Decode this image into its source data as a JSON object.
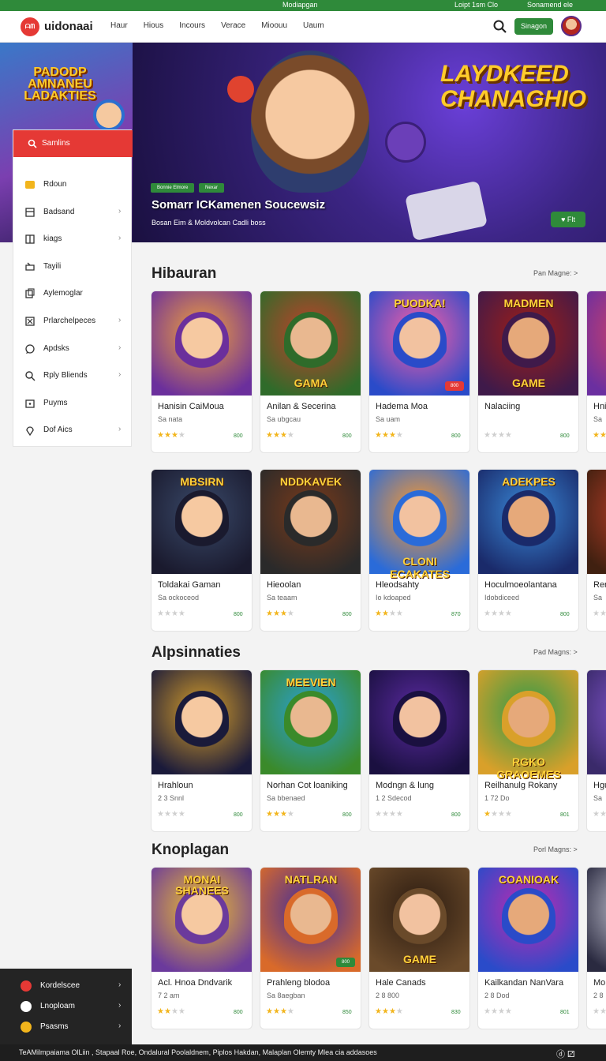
{
  "topstrip": {
    "center": "Modiapgan",
    "right1": "Loipt 1sm Clo",
    "right2": "Sonamend ele"
  },
  "header": {
    "logo_mark": "ᗩᗰ",
    "logo": "uidonaai",
    "nav": [
      "Haur",
      "Hious",
      "Incours",
      "Verace",
      "Mioouu",
      "Uaum"
    ],
    "button": "Sinagon"
  },
  "hero": {
    "left_art_text": "PADODP AMNANEU LADAKTIES",
    "title": "LAYDKEED CHANAGHIO",
    "tag1": "Bonnie Elmore",
    "tag2": "Nexar",
    "subtitle": "Somarr ICKamenen Soucewsiz",
    "caption": "Bosan Eim & Moldvolcan Cadli boss",
    "play_label": "Flt"
  },
  "sidebar": {
    "search_label": "Samlins",
    "items": [
      {
        "label": "Rdoun",
        "icon": "crown-icon",
        "chevron": false
      },
      {
        "label": "Badsand",
        "icon": "box-icon",
        "chevron": true
      },
      {
        "label": "kiags",
        "icon": "bookmark-icon",
        "chevron": true
      },
      {
        "label": "Tayili",
        "icon": "gamepad-icon",
        "chevron": false
      },
      {
        "label": "Aylemoglar",
        "icon": "cards-icon",
        "chevron": false
      },
      {
        "label": "Prlarchelpeces",
        "icon": "grid-icon",
        "chevron": true
      },
      {
        "label": "Apdsks",
        "icon": "chat-icon",
        "chevron": true
      },
      {
        "label": "Rply Bliends",
        "icon": "search-icon",
        "chevron": true
      },
      {
        "label": "Puyms",
        "icon": "dice-icon",
        "chevron": false
      },
      {
        "label": "Dof Aics",
        "icon": "pin-icon",
        "chevron": true
      }
    ]
  },
  "bottom_panel": {
    "items": [
      {
        "label": "Kordelscee",
        "icon": "shield-icon",
        "color": "#e53935"
      },
      {
        "label": "Lnoploam",
        "icon": "envelope-icon",
        "color": "#ffffff"
      },
      {
        "label": "Psasms",
        "icon": "coin-icon",
        "color": "#f2b51c"
      }
    ]
  },
  "sections": [
    {
      "title": "Hibauran",
      "see_more": "Pan Magne: >",
      "cards": [
        {
          "title": "Hanisin CaiMoua",
          "sub": "Sa nata",
          "stars": 3,
          "meta": "800",
          "caption": "",
          "caption2": "",
          "badge": ""
        },
        {
          "title": "Anilan & Secerina",
          "sub": "Sa ubgcau",
          "stars": 3,
          "meta": "800",
          "caption": "",
          "caption2": "GAMA",
          "badge": ""
        },
        {
          "title": "Hadema Moa",
          "sub": "Sa uam",
          "stars": 3,
          "meta": "800",
          "caption": "PUODKA!",
          "caption2": "",
          "badge": "800"
        },
        {
          "title": "Nalaciing",
          "sub": "",
          "stars": 0,
          "meta": "800",
          "caption": "MADMEN",
          "caption2": "GAME",
          "badge": ""
        },
        {
          "title": "Hni",
          "sub": "Sa",
          "stars": 3,
          "meta": "",
          "caption": "",
          "caption2": "",
          "badge": ""
        }
      ]
    },
    {
      "title": "",
      "see_more": "",
      "cards": [
        {
          "title": "Toldakai Gaman",
          "sub": "Sa ockoceod",
          "stars": 0,
          "meta": "800",
          "caption": "MBSIRN",
          "caption2": "",
          "badge": ""
        },
        {
          "title": "Hieoolan",
          "sub": "Sa teaam",
          "stars": 3,
          "meta": "800",
          "caption": "NDDKAVEK",
          "caption2": "",
          "badge": ""
        },
        {
          "title": "Hleodsahty",
          "sub": "Io kdoaped",
          "stars": 2,
          "meta": "870",
          "caption": "",
          "caption2": "CLONI ECAKATES",
          "badge": ""
        },
        {
          "title": "Hoculmoeolantana",
          "sub": "Idobdiceed",
          "stars": 0,
          "meta": "800",
          "caption": "ADEKPES",
          "caption2": "",
          "badge": ""
        },
        {
          "title": "Rer",
          "sub": "Sa",
          "stars": 0,
          "meta": "",
          "caption": "",
          "caption2": "",
          "badge": ""
        }
      ]
    },
    {
      "title": "Alpsinnaties",
      "see_more": "Pad Magns: >",
      "cards": [
        {
          "title": "Hrahloun",
          "sub": "2 3 Snnl",
          "stars": 0,
          "meta": "800",
          "caption": "",
          "caption2": "",
          "badge": ""
        },
        {
          "title": "Norhan Cot loaniking",
          "sub": "Sa bbenaed",
          "stars": 3,
          "meta": "800",
          "caption": "MEEVIEN",
          "caption2": "",
          "badge": ""
        },
        {
          "title": "Modngn & lung",
          "sub": "1 2 Sdecod",
          "stars": 0,
          "meta": "800",
          "caption": "",
          "caption2": "",
          "badge": ""
        },
        {
          "title": "Reilhanulg Rokany",
          "sub": "1 72 Do",
          "stars": 1,
          "meta": "801",
          "caption": "",
          "caption2": "RGKO GRAOEMES",
          "badge": ""
        },
        {
          "title": "Hgu",
          "sub": "Sa",
          "stars": 0,
          "meta": "",
          "caption": "",
          "caption2": "",
          "badge": ""
        }
      ]
    },
    {
      "title": "Knoplagan",
      "see_more": "Porl Magns: >",
      "cards": [
        {
          "title": "Acl. Hnoa Dndvarik",
          "sub": "7 2 am",
          "stars": 2,
          "meta": "800",
          "caption": "MONAI SHANEES",
          "caption2": "",
          "badge": ""
        },
        {
          "title": "Prahleng blodoa",
          "sub": "Sa 8aegban",
          "stars": 3,
          "meta": "850",
          "caption": "NATLRAN",
          "caption2": "",
          "badge": "800"
        },
        {
          "title": "Hale Canads",
          "sub": "2 8 800",
          "stars": 3,
          "meta": "830",
          "caption": "",
          "caption2": "GAME",
          "badge": ""
        },
        {
          "title": "Kailkandan NanVara",
          "sub": "2 8 Dod",
          "stars": 0,
          "meta": "801",
          "caption": "COANIOAK",
          "caption2": "",
          "badge": ""
        },
        {
          "title": "Mor",
          "sub": "2 8",
          "stars": 0,
          "meta": "",
          "caption": "",
          "caption2": "",
          "badge": ""
        }
      ]
    }
  ],
  "footer": {
    "text": "TeAMilmpaiama OlLiin , Stapaal Roe, Ondalural Poolaldnem, Piplos Hakdan, Malaplan Olemty Mlea cia addasoes",
    "icons": "ⓓ ⚂"
  }
}
